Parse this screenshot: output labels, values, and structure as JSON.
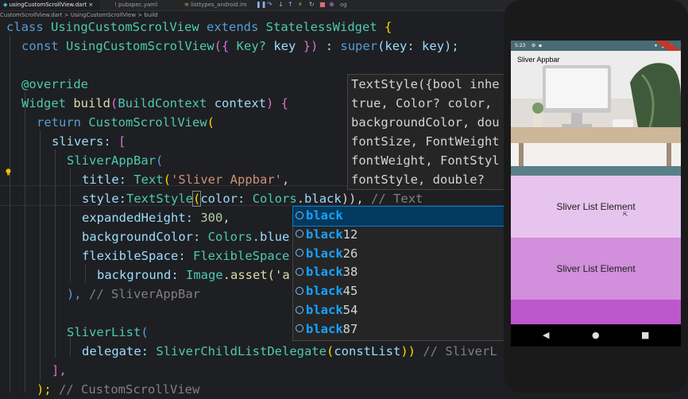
{
  "tabs": [
    {
      "label": "usingCustomScrollView.dart",
      "active": true
    },
    {
      "label": "pubspec.yaml"
    },
    {
      "label": "listtypes_android.im"
    },
    {
      "label": "og"
    }
  ],
  "breadcrumb": "CustomScrollView.dart > UsingCustomScrollView > build",
  "code": {
    "l1": {
      "kw": "class",
      "name": "UsingCustomScrolView",
      "ext": "extends",
      "base": "StatelessWidget",
      "brace": "{"
    },
    "l2": {
      "kw": "const",
      "name": "UsingCustomScrolView",
      "open": "({",
      "t": "Key?",
      "p": "key",
      "close": "})",
      "colon": ":",
      "sup": "super",
      "arg": "(key: key);"
    },
    "l4": "@override",
    "l5": {
      "t1": "Widget",
      "fn": "build",
      "o": "(",
      "t2": "BuildContext",
      "p": "context",
      "c": ") {"
    },
    "l6": {
      "kw": "return",
      "ty": "CustomScrollView",
      "o": "("
    },
    "l7": {
      "p": "slivers:",
      "o": "["
    },
    "l8": {
      "ty": "SliverAppBar",
      "o": "("
    },
    "l9": {
      "p": "title:",
      "ty": "Text",
      "o": "(",
      "s": "'Sliver Appbar'",
      "c": ","
    },
    "l10": {
      "p": "style:",
      "ty": "TextStyle",
      "o": "(",
      "p2": "color:",
      "c1": "Colors",
      "dot": ".",
      "v": "black",
      "c": ")),",
      "cm": "// Text"
    },
    "l11": {
      "p": "expandedHeight:",
      "n": "300",
      "c": ","
    },
    "l12": {
      "p": "backgroundColor:",
      "ty": "Colors",
      "v": ".blue"
    },
    "l13": {
      "p": "flexibleSpace:",
      "ty": "FlexibleSpace"
    },
    "l14": {
      "p": "background:",
      "ty": "Image",
      "v": ".asset('a"
    },
    "l15": {
      "c": "),",
      "cm": "// SliverAppBar"
    },
    "l17": {
      "ty": "SliverList",
      "o": "("
    },
    "l18": {
      "p": "delegate:",
      "ty": "SliverChildListDelegate",
      "o": "(",
      "v": "constList",
      "c": "))",
      "cm": "// SliverL"
    },
    "l19": "],",
    "l20": {
      "c": ");",
      "cm": "// CustomScrollView"
    }
  },
  "tooltip": [
    "TextStyle({bool inhe",
    "true, Color? color,",
    "backgroundColor, dou",
    "fontSize, FontWeight",
    "fontWeight, FontStyl",
    "fontStyle, double?"
  ],
  "suggestions": [
    {
      "match": "black",
      "rest": ""
    },
    {
      "match": "black",
      "rest": "12"
    },
    {
      "match": "black",
      "rest": "26"
    },
    {
      "match": "black",
      "rest": "38"
    },
    {
      "match": "black",
      "rest": "45"
    },
    {
      "match": "black",
      "rest": "54"
    },
    {
      "match": "black",
      "rest": "87"
    }
  ],
  "phone": {
    "time": "5:23",
    "appbar_title": "Sliver Appbar",
    "list_items": [
      "Sliver List Element",
      "Sliver List Element"
    ]
  }
}
